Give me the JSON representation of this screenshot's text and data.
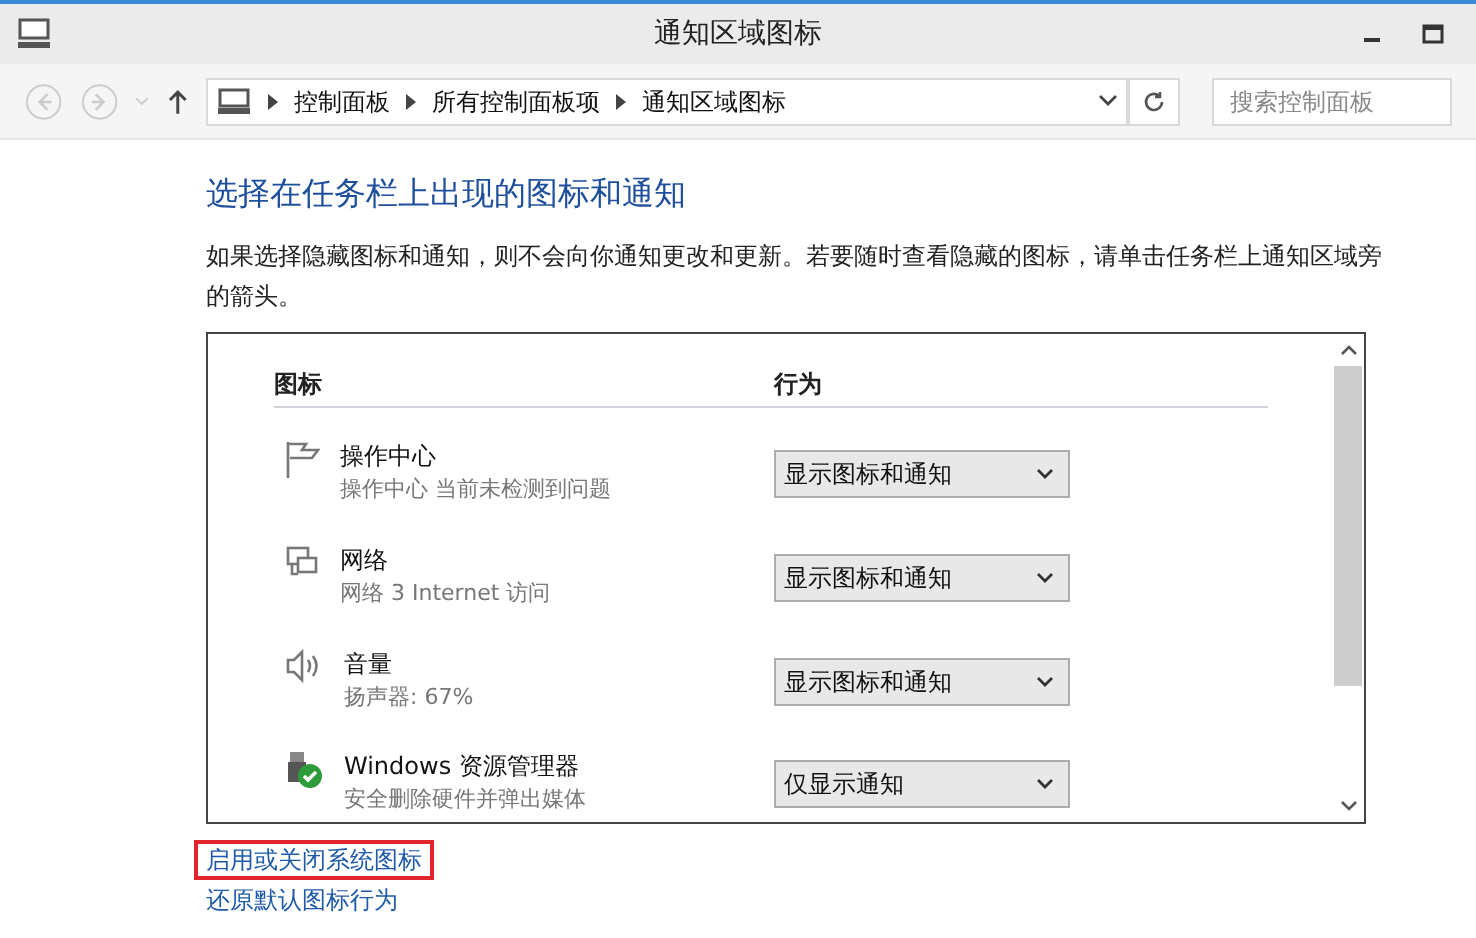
{
  "window": {
    "title": "通知区域图标"
  },
  "address_bar": {
    "crumbs": [
      "控制面板",
      "所有控制面板项",
      "通知区域图标"
    ]
  },
  "search": {
    "placeholder": "搜索控制面板"
  },
  "heading": "选择在任务栏上出现的图标和通知",
  "description": "如果选择隐藏图标和通知，则不会向你通知更改和更新。若要随时查看隐藏的图标，请单击任务栏上通知区域旁的箭头。",
  "table": {
    "columns": [
      "图标",
      "行为"
    ],
    "rows": [
      {
        "kind": "flag",
        "name": "操作中心",
        "detail": "操作中心  当前未检测到问题",
        "behavior": "显示图标和通知"
      },
      {
        "kind": "network",
        "name": "网络",
        "detail": "网络  3 Internet 访问",
        "behavior": "显示图标和通知"
      },
      {
        "kind": "speaker",
        "name": "音量",
        "detail": "扬声器: 67%",
        "behavior": "显示图标和通知"
      },
      {
        "kind": "usb",
        "name": "Windows 资源管理器",
        "detail": "安全删除硬件并弹出媒体",
        "behavior": "仅显示通知"
      }
    ]
  },
  "links": [
    {
      "label": "启用或关闭系统图标",
      "highlighted": true
    },
    {
      "label": "还原默认图标行为",
      "highlighted": false
    }
  ]
}
